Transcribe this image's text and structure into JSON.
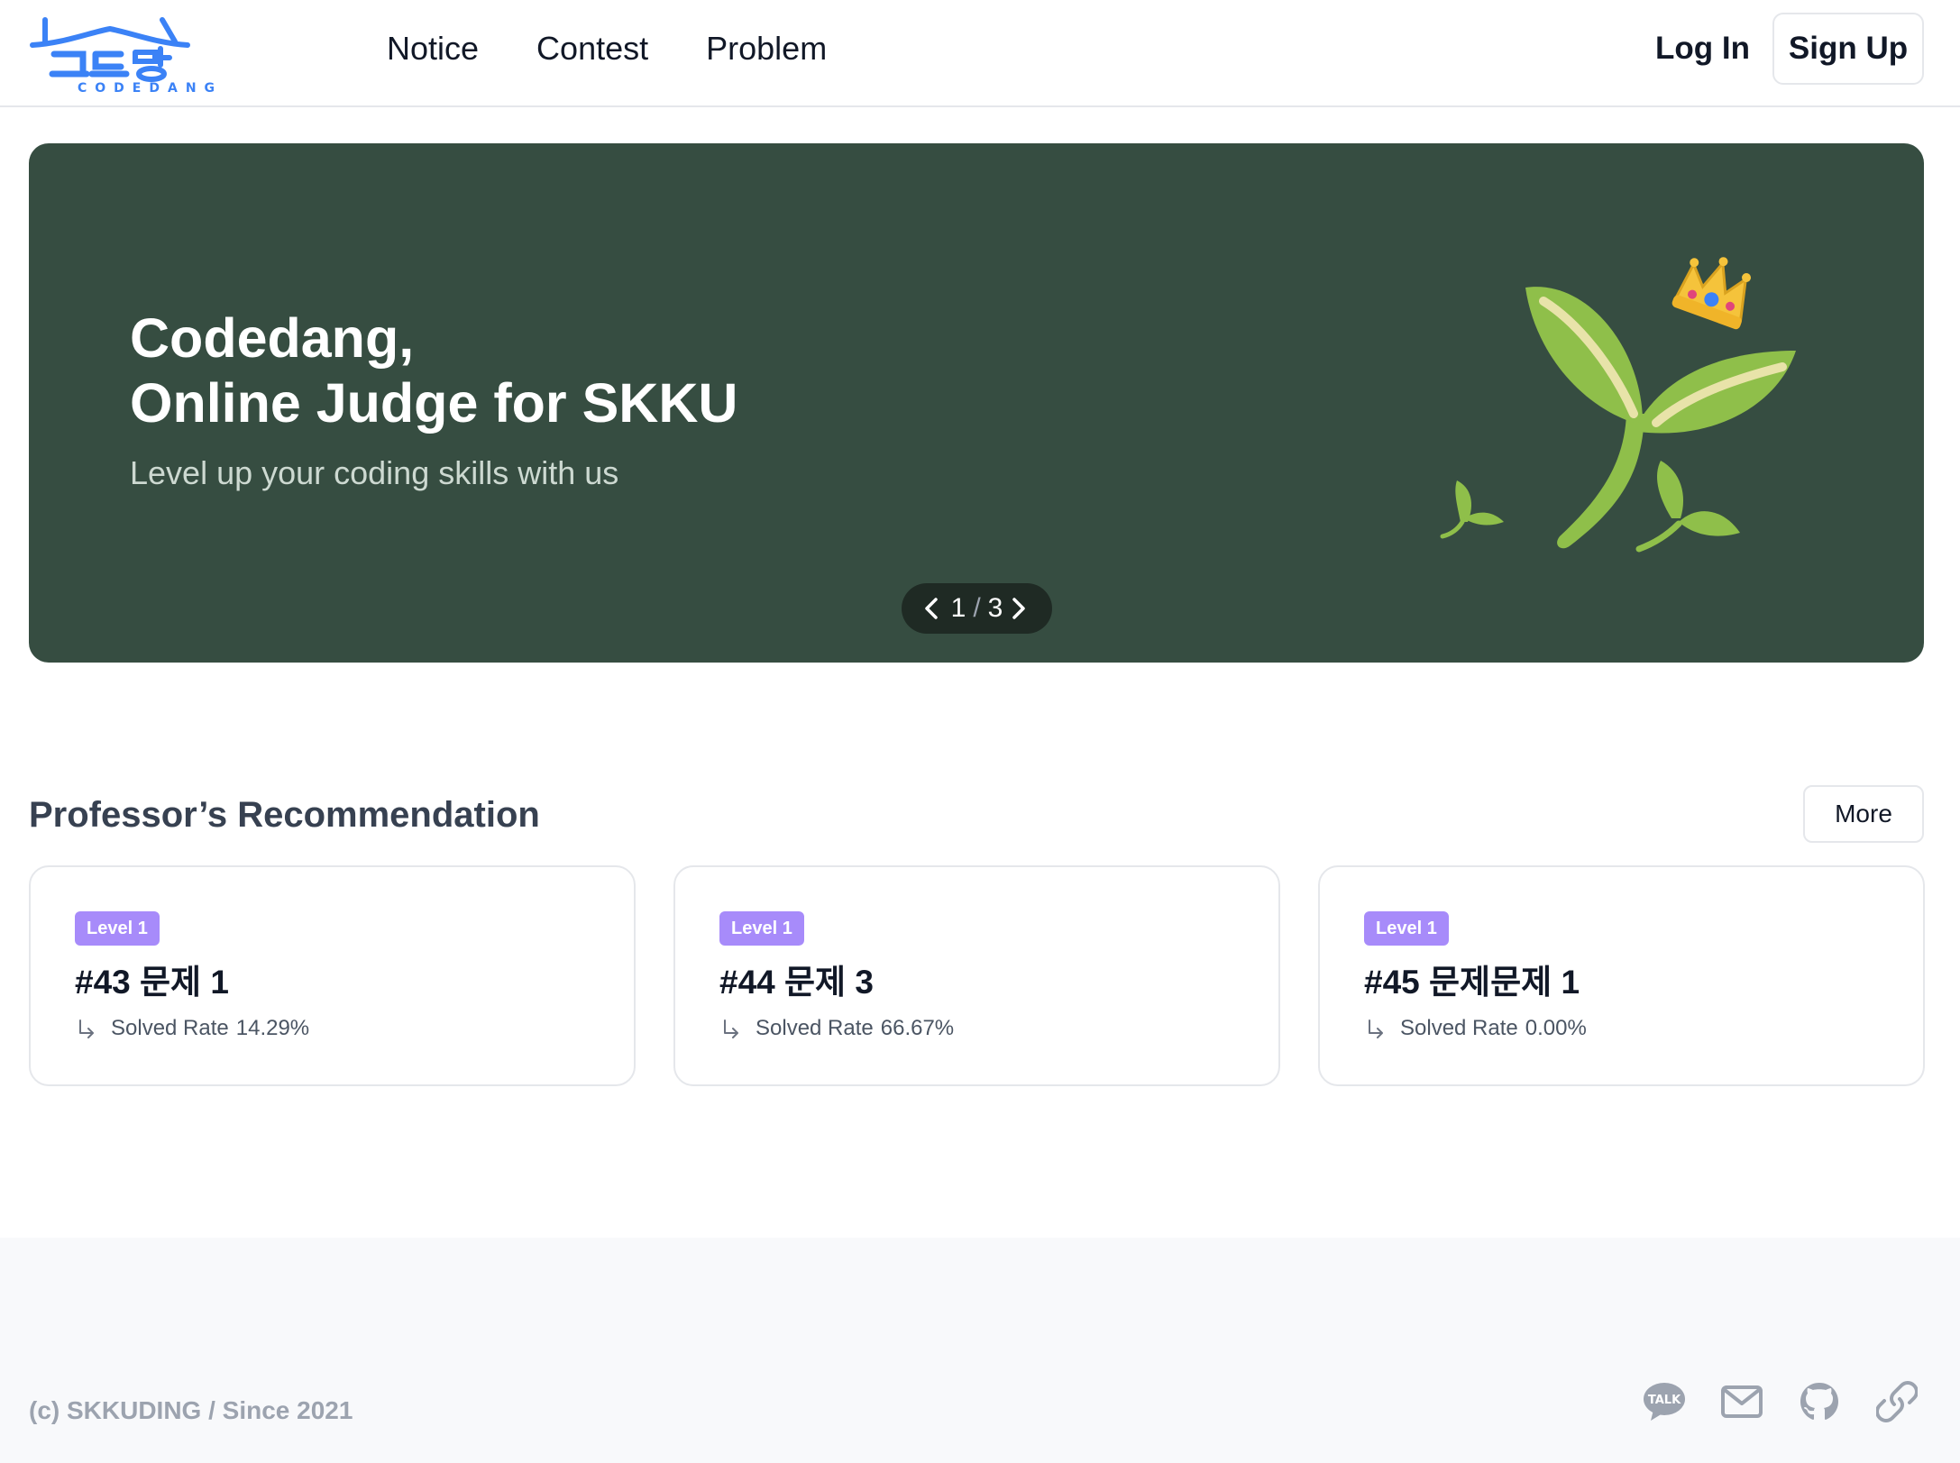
{
  "header": {
    "logo_wordmark": "CODEDANG",
    "nav": [
      {
        "label": "Notice"
      },
      {
        "label": "Contest"
      },
      {
        "label": "Problem"
      }
    ],
    "login_label": "Log In",
    "signup_label": "Sign Up"
  },
  "hero": {
    "title_line1": "Codedang,",
    "title_line2": "Online Judge for SKKU",
    "subtitle": "Level up your coding skills with us",
    "pager": {
      "current": "1",
      "separator": "/",
      "total": "3"
    },
    "background_color": "#364d41"
  },
  "recommendation": {
    "title": "Professor’s Recommendation",
    "more_label": "More",
    "rate_label": "Solved Rate",
    "cards": [
      {
        "level": "Level 1",
        "title": "#43 문제 1",
        "solved_rate": "14.29%"
      },
      {
        "level": "Level 1",
        "title": "#44 문제 3",
        "solved_rate": "66.67%"
      },
      {
        "level": "Level 1",
        "title": "#45 문제문제 1",
        "solved_rate": "0.00%"
      }
    ],
    "badge_color": "#a78bfa"
  },
  "footer": {
    "copyright": "(c) SKKUDING / Since 2021",
    "social_icons": [
      "kakaotalk-icon",
      "mail-icon",
      "github-icon",
      "link-icon"
    ]
  },
  "colors": {
    "brand_blue": "#3b82f6",
    "leaf_green": "#8fbf4a",
    "crown_gold": "#f5c33b"
  }
}
